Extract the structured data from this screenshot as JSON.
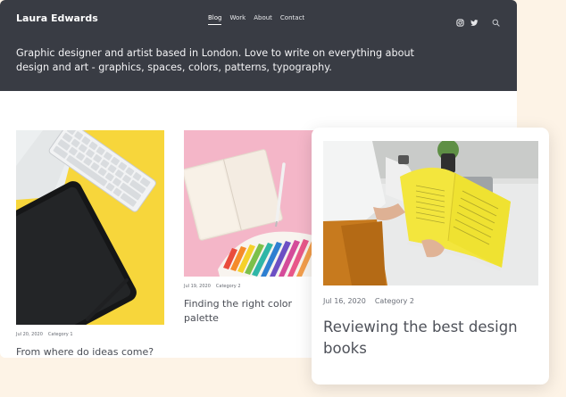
{
  "header": {
    "brand": "Laura Edwards",
    "nav": [
      "Blog",
      "Work",
      "About",
      "Contact"
    ],
    "active_nav": "Blog",
    "icons": [
      "instagram-icon",
      "twitter-icon",
      "search-icon"
    ],
    "tagline": "Graphic designer and artist based in London. Love to write on everything about design and art - graphics, spaces, colors, patterns, typography."
  },
  "posts": [
    {
      "date": "Jul 20, 2020",
      "category": "Category 1",
      "title": "From where do ideas come?"
    },
    {
      "date": "Jul 19, 2020",
      "category": "Category 2",
      "title": "Finding the right color palette"
    },
    {
      "date": "Jul 16, 2020",
      "category": "Category 2",
      "title": "Reviewing the best design books"
    }
  ],
  "colors": {
    "header_bg": "#393c44",
    "page_bg": "#fdf3e6",
    "accent_yellow": "#f7d63b",
    "accent_pink": "#f4b6c8"
  }
}
